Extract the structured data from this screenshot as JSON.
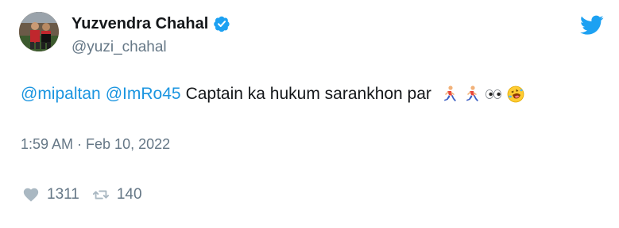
{
  "author": {
    "display_name": "Yuzvendra Chahal",
    "handle": "@yuzi_chahal",
    "verified": true
  },
  "tweet": {
    "mention_1": "@mipaltan",
    "mention_2": "@ImRo45",
    "text": "Captain ka hukum sarankhon par",
    "emojis": [
      "runner-emoji",
      "runner-emoji",
      "eyes-emoji",
      "rofl-emoji"
    ]
  },
  "meta": {
    "timestamp": "1:59 AM · Feb 10, 2022"
  },
  "engagement": {
    "likes": "1311",
    "retweets": "140"
  },
  "colors": {
    "mention": "#1b95e0",
    "twitter_blue": "#1da1f2",
    "muted": "#657786",
    "text": "#14171a"
  },
  "icons": {
    "verified": "verified-badge-icon",
    "brand": "twitter-bird-icon",
    "like": "heart-icon",
    "retweet": "retweet-icon"
  }
}
